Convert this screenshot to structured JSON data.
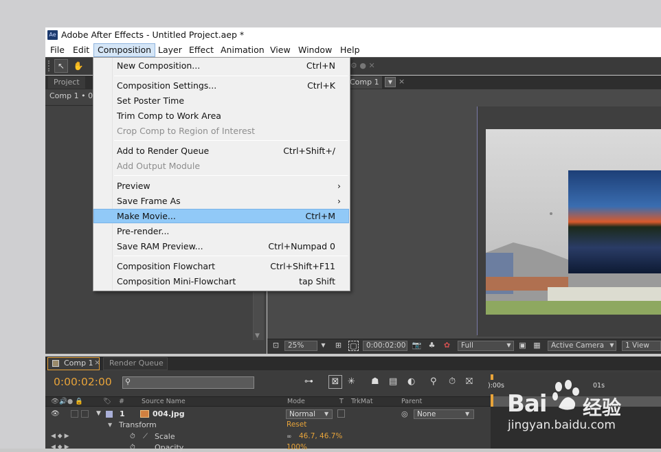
{
  "window": {
    "title": "Adobe After Effects - Untitled Project.aep *",
    "logo_text": "Ae"
  },
  "menubar": [
    "File",
    "Edit",
    "Composition",
    "Layer",
    "Effect",
    "Animation",
    "View",
    "Window",
    "Help"
  ],
  "menubar_active": "Composition",
  "panels": {
    "project_tab": "Project",
    "project_sub": "Comp 1 • 00",
    "comp_tab": "Comp 1",
    "comp_bottom": {
      "zoom": "25%",
      "timecode": "0:00:02:00",
      "resolution": "Full",
      "camera": "Active Camera",
      "views": "1 View"
    }
  },
  "dropdown": {
    "groups": [
      [
        {
          "label": "New Composition...",
          "shortcut": "Ctrl+N",
          "enabled": true
        }
      ],
      [
        {
          "label": "Composition Settings...",
          "shortcut": "Ctrl+K",
          "enabled": true
        },
        {
          "label": "Set Poster Time",
          "shortcut": "",
          "enabled": true
        },
        {
          "label": "Trim Comp to Work Area",
          "shortcut": "",
          "enabled": true
        },
        {
          "label": "Crop Comp to Region of Interest",
          "shortcut": "",
          "enabled": false
        }
      ],
      [
        {
          "label": "Add to Render Queue",
          "shortcut": "Ctrl+Shift+/",
          "enabled": true
        },
        {
          "label": "Add Output Module",
          "shortcut": "",
          "enabled": false
        }
      ],
      [
        {
          "label": "Preview",
          "shortcut": "›",
          "enabled": true
        },
        {
          "label": "Save Frame As",
          "shortcut": "›",
          "enabled": true
        },
        {
          "label": "Make Movie...",
          "shortcut": "Ctrl+M",
          "enabled": true,
          "highlighted": true
        },
        {
          "label": "Pre-render...",
          "shortcut": "",
          "enabled": true
        },
        {
          "label": "Save RAM Preview...",
          "shortcut": "Ctrl+Numpad 0",
          "enabled": true
        }
      ],
      [
        {
          "label": "Composition Flowchart",
          "shortcut": "Ctrl+Shift+F11",
          "enabled": true
        },
        {
          "label": "Composition Mini-Flowchart",
          "shortcut": "tap Shift",
          "enabled": true
        }
      ]
    ]
  },
  "timeline": {
    "tab_comp": "Comp 1",
    "tab_render": "Render Queue",
    "current_time": "0:00:02:00",
    "search_placeholder": "",
    "headers": {
      "num": "#",
      "source": "Source Name",
      "mode": "Mode",
      "t": "T",
      "trkmat": "TrkMat",
      "parent": "Parent"
    },
    "layer": {
      "number": "1",
      "name": "004.jpg",
      "mode": "Normal",
      "parent": "None"
    },
    "transform_label": "Transform",
    "transform_reset": "Reset",
    "scale_label": "Scale",
    "scale_value": "46.7, 46.7%",
    "opacity_label": "Opacity",
    "opacity_value": "100%",
    "ruler": {
      "start": "):00s",
      "mark": "01s"
    }
  },
  "watermark": {
    "brand": "Bai",
    "brand2": "经验",
    "url": "jingyan.baidu.com"
  },
  "colors": {
    "accent_orange": "#e8a43a",
    "menu_highlight": "#91c9f7",
    "panel_dark": "#3c3c3c"
  }
}
